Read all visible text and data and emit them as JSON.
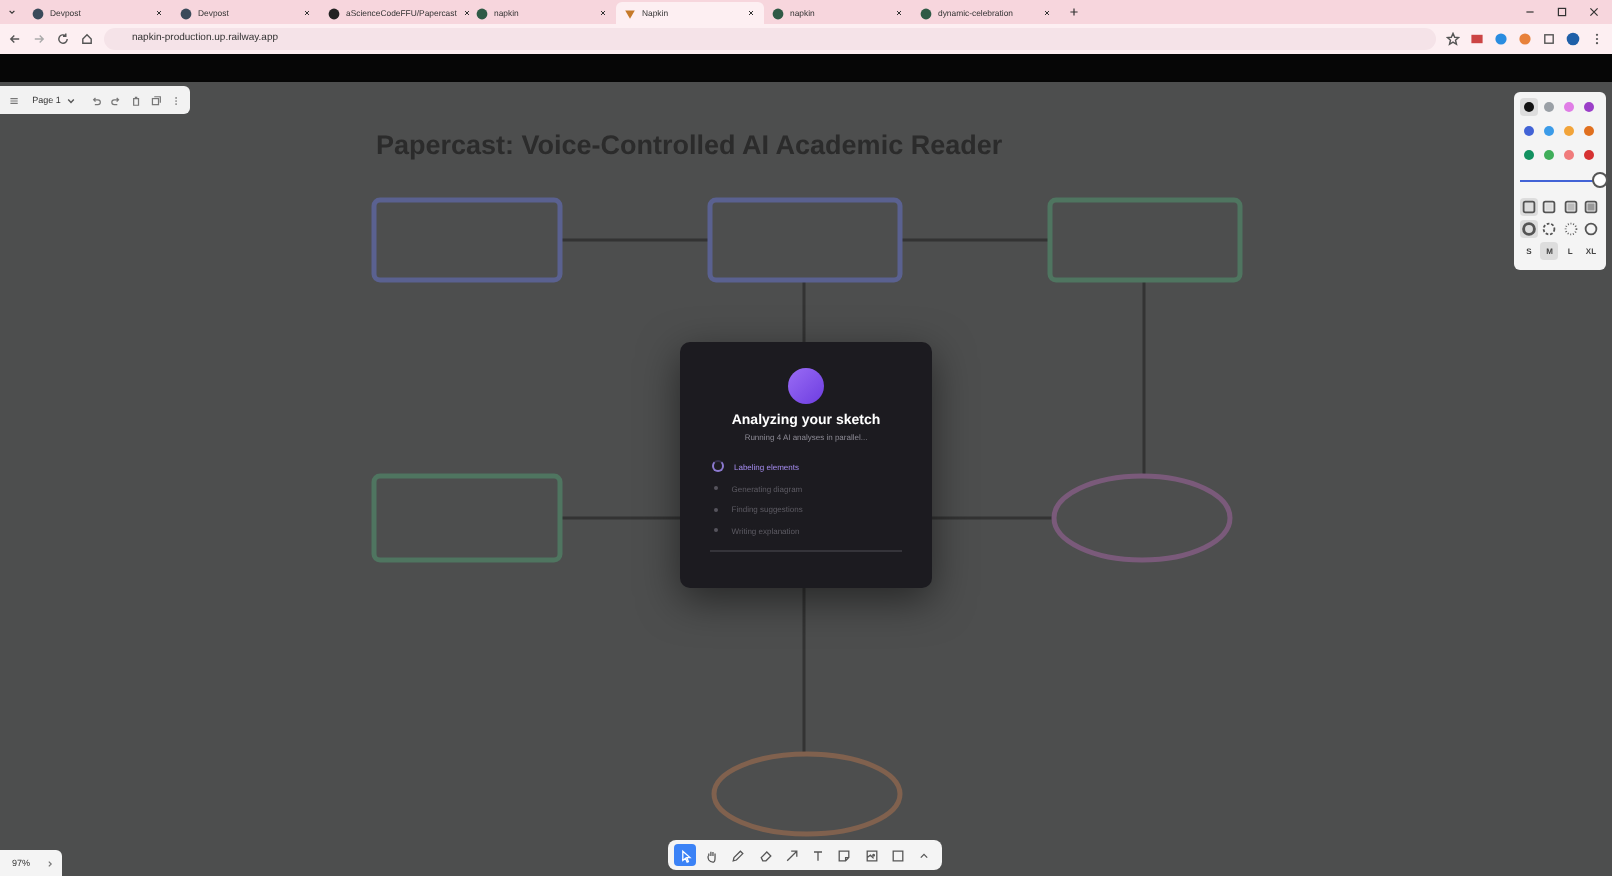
{
  "browser": {
    "tabs": [
      {
        "title": "Devpost",
        "selected": false,
        "kind": "devpost"
      },
      {
        "title": "Devpost",
        "selected": false,
        "kind": "devpost"
      },
      {
        "title": "aScienceCodeFFU/Papercast",
        "selected": false,
        "kind": "github"
      },
      {
        "title": "napkin",
        "selected": false,
        "kind": "napkin"
      },
      {
        "title": "Napkin",
        "selected": true,
        "kind": "napkin-app"
      },
      {
        "title": "napkin",
        "selected": false,
        "kind": "napkin"
      },
      {
        "title": "dynamic-celebration",
        "selected": false,
        "kind": "napkin"
      }
    ],
    "url": "napkin-production.up.railway.app"
  },
  "page_toolbar": {
    "page": "Page 1"
  },
  "canvas": {
    "title": "Papercast: Voice-Controlled AI Academic Reader"
  },
  "style_panel": {
    "colors": [
      {
        "color": "#111111",
        "selected": true
      },
      {
        "color": "#9aa0a6",
        "selected": false
      },
      {
        "color": "#e07ee6",
        "selected": false
      },
      {
        "color": "#9b3fc8",
        "selected": false
      },
      {
        "color": "#4263d6",
        "selected": false
      },
      {
        "color": "#3b9be8",
        "selected": false
      },
      {
        "color": "#f2a43a",
        "selected": false
      },
      {
        "color": "#e0701f",
        "selected": false
      },
      {
        "color": "#129160",
        "selected": false
      },
      {
        "color": "#3fae5a",
        "selected": false
      },
      {
        "color": "#f07b7b",
        "selected": false
      },
      {
        "color": "#d63232",
        "selected": false
      }
    ],
    "opacity": {
      "level": 1
    },
    "fills": [
      {
        "selected": true
      },
      {
        "selected": false
      },
      {
        "selected": false
      },
      {
        "selected": false
      }
    ],
    "strokes": [
      {
        "selected": true
      },
      {
        "selected": false
      },
      {
        "selected": false
      },
      {
        "selected": false
      }
    ],
    "sizes": [
      {
        "label": "S",
        "selected": false
      },
      {
        "label": "M",
        "selected": true
      },
      {
        "label": "L",
        "selected": false
      },
      {
        "label": "XL",
        "selected": false
      }
    ]
  },
  "modal": {
    "title": "Analyzing your sketch",
    "subtitle": "Running 4 AI analyses in parallel...",
    "steps": [
      {
        "label": "Labeling elements",
        "active": true
      },
      {
        "label": "Generating diagram",
        "active": false
      },
      {
        "label": "Finding suggestions",
        "active": false
      },
      {
        "label": "Writing explanation",
        "active": false
      }
    ]
  },
  "tools": [
    {
      "kind": "select",
      "selected": true
    },
    {
      "kind": "hand",
      "selected": false
    },
    {
      "kind": "pencil",
      "selected": false
    },
    {
      "kind": "eraser",
      "selected": false
    },
    {
      "kind": "arrow",
      "selected": false
    },
    {
      "kind": "text",
      "selected": false
    },
    {
      "kind": "note",
      "selected": false
    },
    {
      "kind": "image",
      "selected": false
    },
    {
      "kind": "rectangle",
      "selected": false
    },
    {
      "kind": "more",
      "selected": false
    }
  ],
  "zoom": {
    "value": "97%"
  }
}
